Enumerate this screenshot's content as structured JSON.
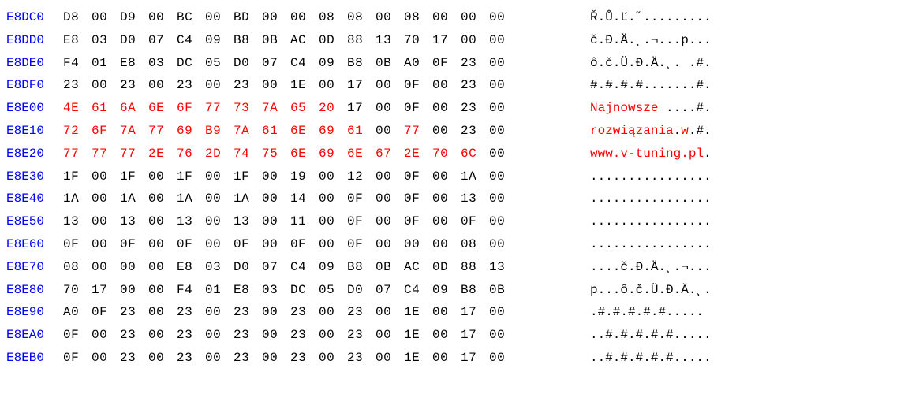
{
  "rows": [
    {
      "offset": "E8DC0",
      "hex": [
        {
          "v": "D8",
          "c": "b"
        },
        {
          "v": "00",
          "c": "b"
        },
        {
          "v": "D9",
          "c": "b"
        },
        {
          "v": "00",
          "c": "b"
        },
        {
          "v": "BC",
          "c": "b"
        },
        {
          "v": "00",
          "c": "b"
        },
        {
          "v": "BD",
          "c": "b"
        },
        {
          "v": "00",
          "c": "b"
        },
        {
          "v": "00",
          "c": "b"
        },
        {
          "v": "08",
          "c": "b"
        },
        {
          "v": "08",
          "c": "b"
        },
        {
          "v": "00",
          "c": "b"
        },
        {
          "v": "08",
          "c": "b"
        },
        {
          "v": "00",
          "c": "b"
        },
        {
          "v": "00",
          "c": "b"
        },
        {
          "v": "00",
          "c": "b"
        }
      ],
      "ascii": [
        {
          "v": "Ř.Ů.Ľ.˝.........",
          "c": "b"
        }
      ]
    },
    {
      "offset": "E8DD0",
      "hex": [
        {
          "v": "E8",
          "c": "b"
        },
        {
          "v": "03",
          "c": "b"
        },
        {
          "v": "D0",
          "c": "b"
        },
        {
          "v": "07",
          "c": "b"
        },
        {
          "v": "C4",
          "c": "b"
        },
        {
          "v": "09",
          "c": "b"
        },
        {
          "v": "B8",
          "c": "b"
        },
        {
          "v": "0B",
          "c": "b"
        },
        {
          "v": "AC",
          "c": "b"
        },
        {
          "v": "0D",
          "c": "b"
        },
        {
          "v": "88",
          "c": "b"
        },
        {
          "v": "13",
          "c": "b"
        },
        {
          "v": "70",
          "c": "b"
        },
        {
          "v": "17",
          "c": "b"
        },
        {
          "v": "00",
          "c": "b"
        },
        {
          "v": "00",
          "c": "b"
        }
      ],
      "ascii": [
        {
          "v": "č.Đ.Ä.¸.¬...p...",
          "c": "b"
        }
      ]
    },
    {
      "offset": "E8DE0",
      "hex": [
        {
          "v": "F4",
          "c": "b"
        },
        {
          "v": "01",
          "c": "b"
        },
        {
          "v": "E8",
          "c": "b"
        },
        {
          "v": "03",
          "c": "b"
        },
        {
          "v": "DC",
          "c": "b"
        },
        {
          "v": "05",
          "c": "b"
        },
        {
          "v": "D0",
          "c": "b"
        },
        {
          "v": "07",
          "c": "b"
        },
        {
          "v": "C4",
          "c": "b"
        },
        {
          "v": "09",
          "c": "b"
        },
        {
          "v": "B8",
          "c": "b"
        },
        {
          "v": "0B",
          "c": "b"
        },
        {
          "v": "A0",
          "c": "b"
        },
        {
          "v": "0F",
          "c": "b"
        },
        {
          "v": "23",
          "c": "b"
        },
        {
          "v": "00",
          "c": "b"
        }
      ],
      "ascii": [
        {
          "v": "ô.č.Ü.Đ.Ä.¸. .#.",
          "c": "b"
        }
      ]
    },
    {
      "offset": "E8DF0",
      "hex": [
        {
          "v": "23",
          "c": "b"
        },
        {
          "v": "00",
          "c": "b"
        },
        {
          "v": "23",
          "c": "b"
        },
        {
          "v": "00",
          "c": "b"
        },
        {
          "v": "23",
          "c": "b"
        },
        {
          "v": "00",
          "c": "b"
        },
        {
          "v": "23",
          "c": "b"
        },
        {
          "v": "00",
          "c": "b"
        },
        {
          "v": "1E",
          "c": "b"
        },
        {
          "v": "00",
          "c": "b"
        },
        {
          "v": "17",
          "c": "b"
        },
        {
          "v": "00",
          "c": "b"
        },
        {
          "v": "0F",
          "c": "b"
        },
        {
          "v": "00",
          "c": "b"
        },
        {
          "v": "23",
          "c": "b"
        },
        {
          "v": "00",
          "c": "b"
        }
      ],
      "ascii": [
        {
          "v": "#.#.#.#.......#.",
          "c": "b"
        }
      ]
    },
    {
      "offset": "E8E00",
      "hex": [
        {
          "v": "4E",
          "c": "r"
        },
        {
          "v": "61",
          "c": "r"
        },
        {
          "v": "6A",
          "c": "r"
        },
        {
          "v": "6E",
          "c": "r"
        },
        {
          "v": "6F",
          "c": "r"
        },
        {
          "v": "77",
          "c": "r"
        },
        {
          "v": "73",
          "c": "r"
        },
        {
          "v": "7A",
          "c": "r"
        },
        {
          "v": "65",
          "c": "r"
        },
        {
          "v": "20",
          "c": "r"
        },
        {
          "v": "17",
          "c": "b"
        },
        {
          "v": "00",
          "c": "b"
        },
        {
          "v": "0F",
          "c": "b"
        },
        {
          "v": "00",
          "c": "b"
        },
        {
          "v": "23",
          "c": "b"
        },
        {
          "v": "00",
          "c": "b"
        }
      ],
      "ascii": [
        {
          "v": "Najnowsze ",
          "c": "r"
        },
        {
          "v": "....#.",
          "c": "b"
        }
      ]
    },
    {
      "offset": "E8E10",
      "hex": [
        {
          "v": "72",
          "c": "r"
        },
        {
          "v": "6F",
          "c": "r"
        },
        {
          "v": "7A",
          "c": "r"
        },
        {
          "v": "77",
          "c": "r"
        },
        {
          "v": "69",
          "c": "r"
        },
        {
          "v": "B9",
          "c": "r"
        },
        {
          "v": "7A",
          "c": "r"
        },
        {
          "v": "61",
          "c": "r"
        },
        {
          "v": "6E",
          "c": "r"
        },
        {
          "v": "69",
          "c": "r"
        },
        {
          "v": "61",
          "c": "r"
        },
        {
          "v": "00",
          "c": "b"
        },
        {
          "v": "77",
          "c": "r"
        },
        {
          "v": "00",
          "c": "b"
        },
        {
          "v": "23",
          "c": "b"
        },
        {
          "v": "00",
          "c": "b"
        }
      ],
      "ascii": [
        {
          "v": "rozwiązania",
          "c": "r"
        },
        {
          "v": ".",
          "c": "b"
        },
        {
          "v": "w",
          "c": "r"
        },
        {
          "v": ".#.",
          "c": "b"
        }
      ]
    },
    {
      "offset": "E8E20",
      "hex": [
        {
          "v": "77",
          "c": "r"
        },
        {
          "v": "77",
          "c": "r"
        },
        {
          "v": "77",
          "c": "r"
        },
        {
          "v": "2E",
          "c": "r"
        },
        {
          "v": "76",
          "c": "r"
        },
        {
          "v": "2D",
          "c": "r"
        },
        {
          "v": "74",
          "c": "r"
        },
        {
          "v": "75",
          "c": "r"
        },
        {
          "v": "6E",
          "c": "r"
        },
        {
          "v": "69",
          "c": "r"
        },
        {
          "v": "6E",
          "c": "r"
        },
        {
          "v": "67",
          "c": "r"
        },
        {
          "v": "2E",
          "c": "r"
        },
        {
          "v": "70",
          "c": "r"
        },
        {
          "v": "6C",
          "c": "r"
        },
        {
          "v": "00",
          "c": "b"
        }
      ],
      "ascii": [
        {
          "v": "www.v-tuning.pl",
          "c": "r"
        },
        {
          "v": ".",
          "c": "b"
        }
      ]
    },
    {
      "offset": "E8E30",
      "hex": [
        {
          "v": "1F",
          "c": "b"
        },
        {
          "v": "00",
          "c": "b"
        },
        {
          "v": "1F",
          "c": "b"
        },
        {
          "v": "00",
          "c": "b"
        },
        {
          "v": "1F",
          "c": "b"
        },
        {
          "v": "00",
          "c": "b"
        },
        {
          "v": "1F",
          "c": "b"
        },
        {
          "v": "00",
          "c": "b"
        },
        {
          "v": "19",
          "c": "b"
        },
        {
          "v": "00",
          "c": "b"
        },
        {
          "v": "12",
          "c": "b"
        },
        {
          "v": "00",
          "c": "b"
        },
        {
          "v": "0F",
          "c": "b"
        },
        {
          "v": "00",
          "c": "b"
        },
        {
          "v": "1A",
          "c": "b"
        },
        {
          "v": "00",
          "c": "b"
        }
      ],
      "ascii": [
        {
          "v": "................",
          "c": "b"
        }
      ]
    },
    {
      "offset": "E8E40",
      "hex": [
        {
          "v": "1A",
          "c": "b"
        },
        {
          "v": "00",
          "c": "b"
        },
        {
          "v": "1A",
          "c": "b"
        },
        {
          "v": "00",
          "c": "b"
        },
        {
          "v": "1A",
          "c": "b"
        },
        {
          "v": "00",
          "c": "b"
        },
        {
          "v": "1A",
          "c": "b"
        },
        {
          "v": "00",
          "c": "b"
        },
        {
          "v": "14",
          "c": "b"
        },
        {
          "v": "00",
          "c": "b"
        },
        {
          "v": "0F",
          "c": "b"
        },
        {
          "v": "00",
          "c": "b"
        },
        {
          "v": "0F",
          "c": "b"
        },
        {
          "v": "00",
          "c": "b"
        },
        {
          "v": "13",
          "c": "b"
        },
        {
          "v": "00",
          "c": "b"
        }
      ],
      "ascii": [
        {
          "v": "................",
          "c": "b"
        }
      ]
    },
    {
      "offset": "E8E50",
      "hex": [
        {
          "v": "13",
          "c": "b"
        },
        {
          "v": "00",
          "c": "b"
        },
        {
          "v": "13",
          "c": "b"
        },
        {
          "v": "00",
          "c": "b"
        },
        {
          "v": "13",
          "c": "b"
        },
        {
          "v": "00",
          "c": "b"
        },
        {
          "v": "13",
          "c": "b"
        },
        {
          "v": "00",
          "c": "b"
        },
        {
          "v": "11",
          "c": "b"
        },
        {
          "v": "00",
          "c": "b"
        },
        {
          "v": "0F",
          "c": "b"
        },
        {
          "v": "00",
          "c": "b"
        },
        {
          "v": "0F",
          "c": "b"
        },
        {
          "v": "00",
          "c": "b"
        },
        {
          "v": "0F",
          "c": "b"
        },
        {
          "v": "00",
          "c": "b"
        }
      ],
      "ascii": [
        {
          "v": "................",
          "c": "b"
        }
      ]
    },
    {
      "offset": "E8E60",
      "hex": [
        {
          "v": "0F",
          "c": "b"
        },
        {
          "v": "00",
          "c": "b"
        },
        {
          "v": "0F",
          "c": "b"
        },
        {
          "v": "00",
          "c": "b"
        },
        {
          "v": "0F",
          "c": "b"
        },
        {
          "v": "00",
          "c": "b"
        },
        {
          "v": "0F",
          "c": "b"
        },
        {
          "v": "00",
          "c": "b"
        },
        {
          "v": "0F",
          "c": "b"
        },
        {
          "v": "00",
          "c": "b"
        },
        {
          "v": "0F",
          "c": "b"
        },
        {
          "v": "00",
          "c": "b"
        },
        {
          "v": "00",
          "c": "b"
        },
        {
          "v": "00",
          "c": "b"
        },
        {
          "v": "08",
          "c": "b"
        },
        {
          "v": "00",
          "c": "b"
        }
      ],
      "ascii": [
        {
          "v": "................",
          "c": "b"
        }
      ]
    },
    {
      "offset": "E8E70",
      "hex": [
        {
          "v": "08",
          "c": "b"
        },
        {
          "v": "00",
          "c": "b"
        },
        {
          "v": "00",
          "c": "b"
        },
        {
          "v": "00",
          "c": "b"
        },
        {
          "v": "E8",
          "c": "b"
        },
        {
          "v": "03",
          "c": "b"
        },
        {
          "v": "D0",
          "c": "b"
        },
        {
          "v": "07",
          "c": "b"
        },
        {
          "v": "C4",
          "c": "b"
        },
        {
          "v": "09",
          "c": "b"
        },
        {
          "v": "B8",
          "c": "b"
        },
        {
          "v": "0B",
          "c": "b"
        },
        {
          "v": "AC",
          "c": "b"
        },
        {
          "v": "0D",
          "c": "b"
        },
        {
          "v": "88",
          "c": "b"
        },
        {
          "v": "13",
          "c": "b"
        }
      ],
      "ascii": [
        {
          "v": "....č.Đ.Ä.¸.¬...",
          "c": "b"
        }
      ]
    },
    {
      "offset": "E8E80",
      "hex": [
        {
          "v": "70",
          "c": "b"
        },
        {
          "v": "17",
          "c": "b"
        },
        {
          "v": "00",
          "c": "b"
        },
        {
          "v": "00",
          "c": "b"
        },
        {
          "v": "F4",
          "c": "b"
        },
        {
          "v": "01",
          "c": "b"
        },
        {
          "v": "E8",
          "c": "b"
        },
        {
          "v": "03",
          "c": "b"
        },
        {
          "v": "DC",
          "c": "b"
        },
        {
          "v": "05",
          "c": "b"
        },
        {
          "v": "D0",
          "c": "b"
        },
        {
          "v": "07",
          "c": "b"
        },
        {
          "v": "C4",
          "c": "b"
        },
        {
          "v": "09",
          "c": "b"
        },
        {
          "v": "B8",
          "c": "b"
        },
        {
          "v": "0B",
          "c": "b"
        }
      ],
      "ascii": [
        {
          "v": "p...ô.č.Ü.Đ.Ä.¸.",
          "c": "b"
        }
      ]
    },
    {
      "offset": "E8E90",
      "hex": [
        {
          "v": "A0",
          "c": "b"
        },
        {
          "v": "0F",
          "c": "b"
        },
        {
          "v": "23",
          "c": "b"
        },
        {
          "v": "00",
          "c": "b"
        },
        {
          "v": "23",
          "c": "b"
        },
        {
          "v": "00",
          "c": "b"
        },
        {
          "v": "23",
          "c": "b"
        },
        {
          "v": "00",
          "c": "b"
        },
        {
          "v": "23",
          "c": "b"
        },
        {
          "v": "00",
          "c": "b"
        },
        {
          "v": "23",
          "c": "b"
        },
        {
          "v": "00",
          "c": "b"
        },
        {
          "v": "1E",
          "c": "b"
        },
        {
          "v": "00",
          "c": "b"
        },
        {
          "v": "17",
          "c": "b"
        },
        {
          "v": "00",
          "c": "b"
        }
      ],
      "ascii": [
        {
          "v": " .#.#.#.#.#.....",
          "c": "b"
        }
      ]
    },
    {
      "offset": "E8EA0",
      "hex": [
        {
          "v": "0F",
          "c": "b"
        },
        {
          "v": "00",
          "c": "b"
        },
        {
          "v": "23",
          "c": "b"
        },
        {
          "v": "00",
          "c": "b"
        },
        {
          "v": "23",
          "c": "b"
        },
        {
          "v": "00",
          "c": "b"
        },
        {
          "v": "23",
          "c": "b"
        },
        {
          "v": "00",
          "c": "b"
        },
        {
          "v": "23",
          "c": "b"
        },
        {
          "v": "00",
          "c": "b"
        },
        {
          "v": "23",
          "c": "b"
        },
        {
          "v": "00",
          "c": "b"
        },
        {
          "v": "1E",
          "c": "b"
        },
        {
          "v": "00",
          "c": "b"
        },
        {
          "v": "17",
          "c": "b"
        },
        {
          "v": "00",
          "c": "b"
        }
      ],
      "ascii": [
        {
          "v": "..#.#.#.#.#.....",
          "c": "b"
        }
      ]
    },
    {
      "offset": "E8EB0",
      "hex": [
        {
          "v": "0F",
          "c": "b"
        },
        {
          "v": "00",
          "c": "b"
        },
        {
          "v": "23",
          "c": "b"
        },
        {
          "v": "00",
          "c": "b"
        },
        {
          "v": "23",
          "c": "b"
        },
        {
          "v": "00",
          "c": "b"
        },
        {
          "v": "23",
          "c": "b"
        },
        {
          "v": "00",
          "c": "b"
        },
        {
          "v": "23",
          "c": "b"
        },
        {
          "v": "00",
          "c": "b"
        },
        {
          "v": "23",
          "c": "b"
        },
        {
          "v": "00",
          "c": "b"
        },
        {
          "v": "1E",
          "c": "b"
        },
        {
          "v": "00",
          "c": "b"
        },
        {
          "v": "17",
          "c": "b"
        },
        {
          "v": "00",
          "c": "b"
        }
      ],
      "ascii": [
        {
          "v": "..#.#.#.#.#.....",
          "c": "b"
        }
      ]
    }
  ]
}
